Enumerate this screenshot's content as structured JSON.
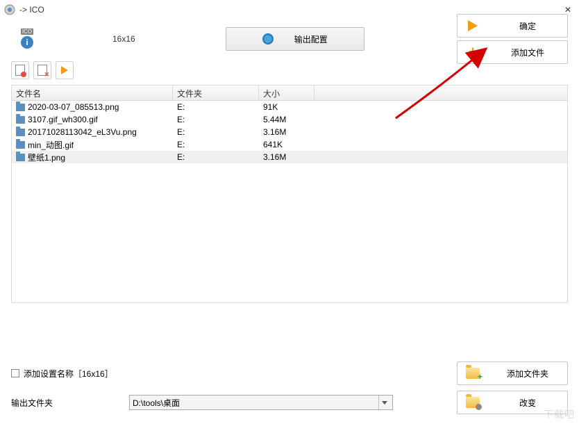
{
  "window": {
    "title": " -> ICO"
  },
  "top": {
    "ico_label": "ICO",
    "size_text": "16x16",
    "output_config": "输出配置",
    "ok_button": "确定",
    "add_file_button": "添加文件"
  },
  "table": {
    "headers": {
      "name": "文件名",
      "folder": "文件夹",
      "size": "大小"
    },
    "rows": [
      {
        "name": "2020-03-07_085513.png",
        "folder": "E:",
        "size": "91K",
        "selected": false
      },
      {
        "name": "3107.gif_wh300.gif",
        "folder": "E:",
        "size": "5.44M",
        "selected": false
      },
      {
        "name": "20171028113042_eL3Vu.png",
        "folder": "E:",
        "size": "3.16M",
        "selected": false
      },
      {
        "name": "min_动图.gif",
        "folder": "E:",
        "size": "641K",
        "selected": false
      },
      {
        "name": "壁纸1.png",
        "folder": "E:",
        "size": "3.16M",
        "selected": true
      }
    ]
  },
  "bottom": {
    "add_setting_name_label": "添加设置名称［16x16］",
    "output_folder_label": "输出文件夹",
    "output_folder_path": "D:\\tools\\桌面",
    "add_folder_button": "添加文件夹",
    "change_button": "改变"
  },
  "watermark": "下载吧"
}
